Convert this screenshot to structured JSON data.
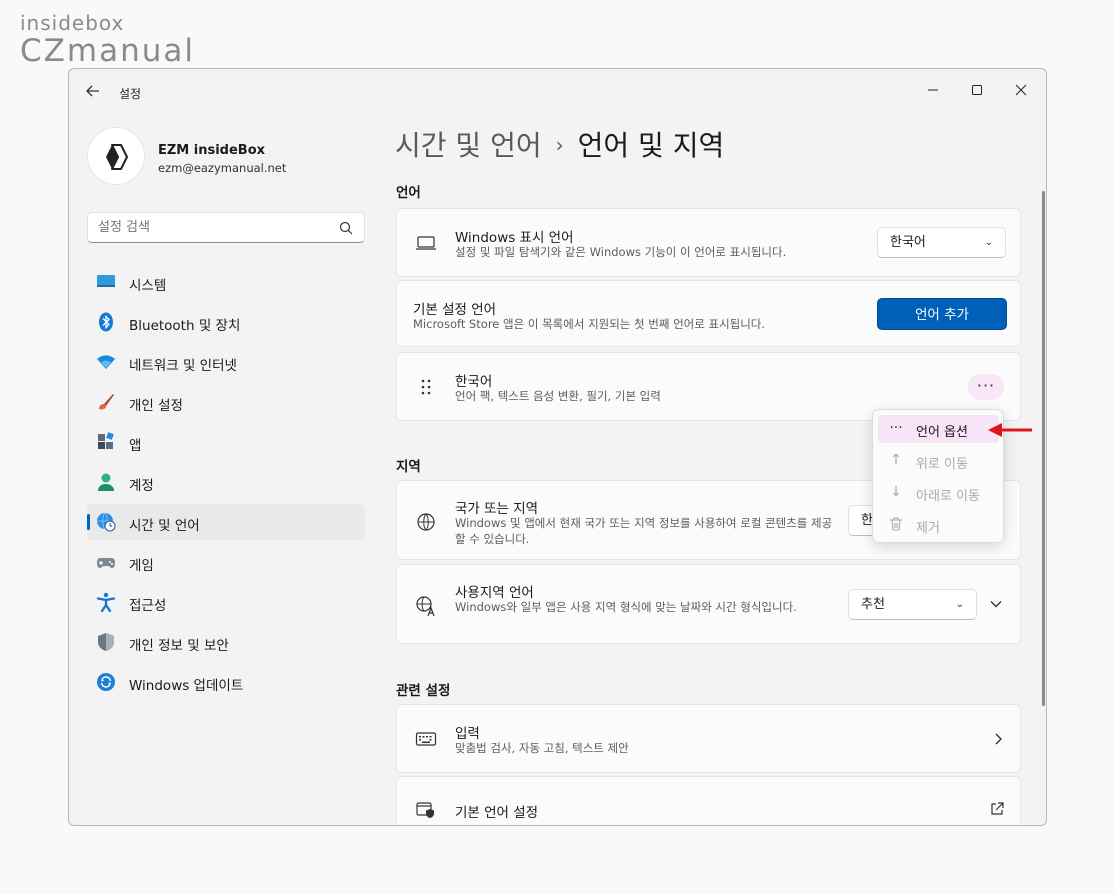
{
  "watermark": {
    "line1": "insidebox",
    "line2": "CZmanual"
  },
  "window": {
    "title": "설정",
    "minimize_icon": "minimize-icon",
    "maximize_icon": "maximize-icon",
    "close_icon": "close-icon"
  },
  "profile": {
    "name": "EZM insideBox",
    "email": "ezm@eazymanual.net"
  },
  "search": {
    "placeholder": "설정 검색"
  },
  "nav": [
    {
      "label": "시스템",
      "icon": "monitor-icon"
    },
    {
      "label": "Bluetooth 및 장치",
      "icon": "bluetooth-icon"
    },
    {
      "label": "네트워크 및 인터넷",
      "icon": "wifi-icon"
    },
    {
      "label": "개인 설정",
      "icon": "brush-icon"
    },
    {
      "label": "앱",
      "icon": "apps-icon"
    },
    {
      "label": "계정",
      "icon": "person-icon"
    },
    {
      "label": "시간 및 언어",
      "icon": "globe-clock-icon",
      "active": true
    },
    {
      "label": "게임",
      "icon": "gamepad-icon"
    },
    {
      "label": "접근성",
      "icon": "accessibility-icon"
    },
    {
      "label": "개인 정보 및 보안",
      "icon": "shield-icon"
    },
    {
      "label": "Windows 업데이트",
      "icon": "update-icon"
    }
  ],
  "breadcrumb": {
    "parent": "시간 및 언어",
    "separator": "›",
    "current": "언어 및 지역"
  },
  "sections": {
    "language": "언어",
    "region": "지역",
    "related": "관련 설정"
  },
  "cards": {
    "display_language": {
      "title": "Windows 표시 언어",
      "subtitle": "설정 및 파일 탐색기와 같은 Windows 기능이 이 언어로 표시됩니다.",
      "value": "한국어"
    },
    "preferred_language": {
      "title": "기본 설정 언어",
      "subtitle": "Microsoft Store 앱은 이 목록에서 지원되는 첫 번째 언어로 표시됩니다.",
      "button": "언어 추가"
    },
    "korean": {
      "title": "한국어",
      "subtitle": "언어 팩, 텍스트 음성 변환, 필기, 기본 입력",
      "more": "···"
    },
    "country": {
      "title": "국가 또는 지역",
      "subtitle": "Windows 및 앱에서 현재 국가 또는 지역 정보를 사용하여 로컬 콘텐츠를 제공할 수 있습니다.",
      "value": "한"
    },
    "regional_format": {
      "title": "사용지역 언어",
      "subtitle": "Windows와 일부 앱은 사용 지역 형식에 맞는 날짜와 시간 형식입니다.",
      "value": "추천"
    },
    "typing": {
      "title": "입력",
      "subtitle": "맞춤법 검사, 자동 고침, 텍스트 제안"
    },
    "admin_language": {
      "title": "기본 언어 설정"
    }
  },
  "context_menu": [
    {
      "label": "언어 옵션",
      "icon": "···",
      "highlighted": true
    },
    {
      "label": "위로 이동",
      "icon": "↑",
      "disabled": true
    },
    {
      "label": "아래로 이동",
      "icon": "↓",
      "disabled": true
    },
    {
      "label": "제거",
      "icon": "trash",
      "disabled": true
    }
  ],
  "colors": {
    "accent": "#005fb8",
    "highlight": "#f7e4f6",
    "arrow": "#e0151b"
  }
}
